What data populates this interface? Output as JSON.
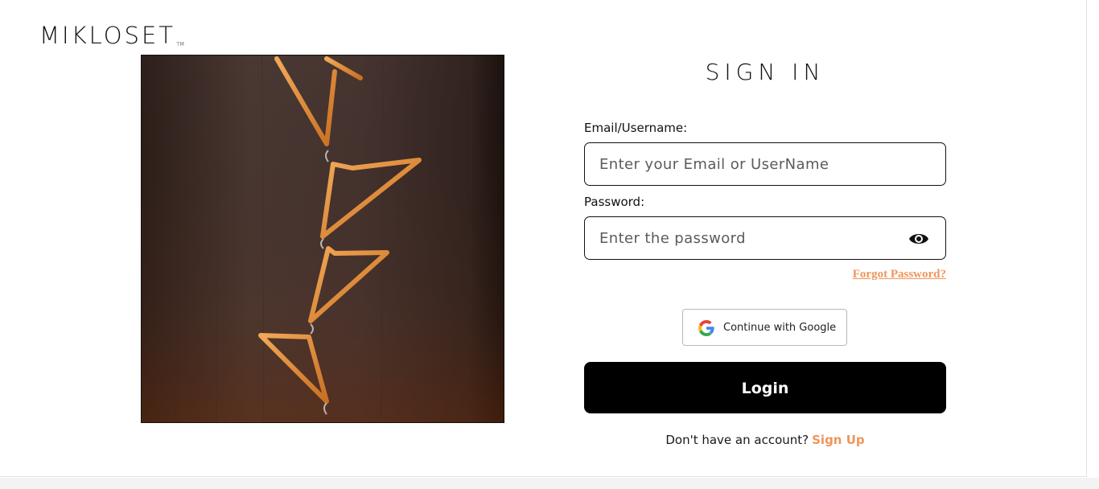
{
  "brand": {
    "logo_text": "MIKLOSET",
    "trademark": "TM"
  },
  "hero": {
    "image_name": "wooden-hangers-on-dark-wood"
  },
  "signin": {
    "title": "SIGN IN",
    "email_label": "Email/Username:",
    "email_placeholder": "Enter your Email or UserName",
    "email_value": "",
    "password_label": "Password:",
    "password_placeholder": "Enter the password",
    "password_value": "",
    "password_toggle_icon": "eye-icon",
    "forgot_password": "Forgot Password?",
    "google_button": "Continue with Google",
    "login_button": "Login",
    "signup_prompt": "Don't have an account?",
    "signup_link": "Sign Up"
  },
  "colors": {
    "accent": "#f0955a",
    "primary_button": "#000000",
    "text": "#111111"
  }
}
